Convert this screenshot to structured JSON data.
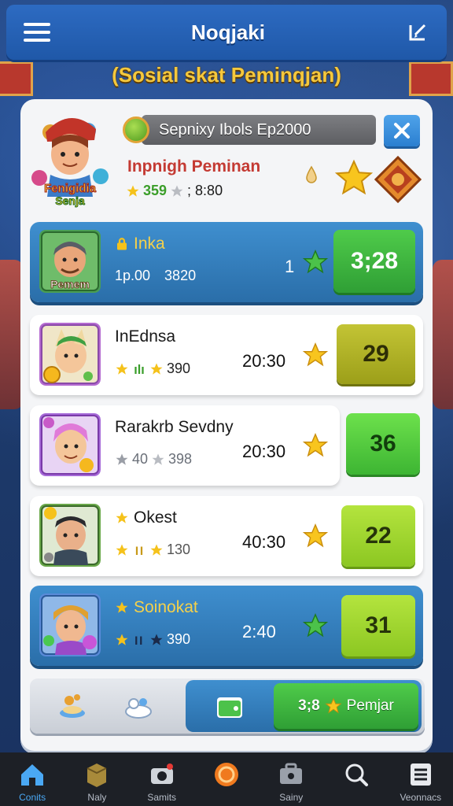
{
  "app": {
    "title": "Noqjaki",
    "subtitle": "(Sosial skat Peminqjan)"
  },
  "search": {
    "value": "Sepnixy Ibols Ep2000"
  },
  "profile": {
    "avatar_label_top": "Fenigidia",
    "avatar_label_bottom": "Senja",
    "name": "Inpnigh Peminan",
    "stat_a": "359",
    "stat_b": "; 8:80"
  },
  "rows": [
    {
      "name": "Inka",
      "stat": "1p.00",
      "stat2": "3820",
      "count": "1",
      "score": "3;28",
      "avatar_label": "Pemem"
    },
    {
      "name": "InEdnsa",
      "stat": "390",
      "time": "20:30",
      "score": "29"
    },
    {
      "name": "Rarakrb Sevdny",
      "stat": "40",
      "stat2": "398",
      "time": "20:30",
      "score": "36"
    },
    {
      "name": "Okest",
      "stat": "130",
      "time": "40:30",
      "score": "22"
    },
    {
      "name": "Soinokat",
      "stat": "390",
      "time": "2:40",
      "score": "31"
    }
  ],
  "action": {
    "label_count": "3;8",
    "label": "Pemjar"
  },
  "nav": [
    {
      "label": "Conits",
      "icon": "home-icon"
    },
    {
      "label": "Naly",
      "icon": "box-icon"
    },
    {
      "label": "Samits",
      "icon": "camera-icon"
    },
    {
      "label": "",
      "icon": "coin-icon"
    },
    {
      "label": "Sainy",
      "icon": "briefcase-icon"
    },
    {
      "label": "",
      "icon": "search-icon"
    },
    {
      "label": "Veonnacs",
      "icon": "list-icon"
    }
  ],
  "colors": {
    "accent_blue": "#2a6ea9",
    "title_gold": "#f5c83c",
    "name_red": "#c43a33",
    "score_green": "#2f9f35"
  }
}
